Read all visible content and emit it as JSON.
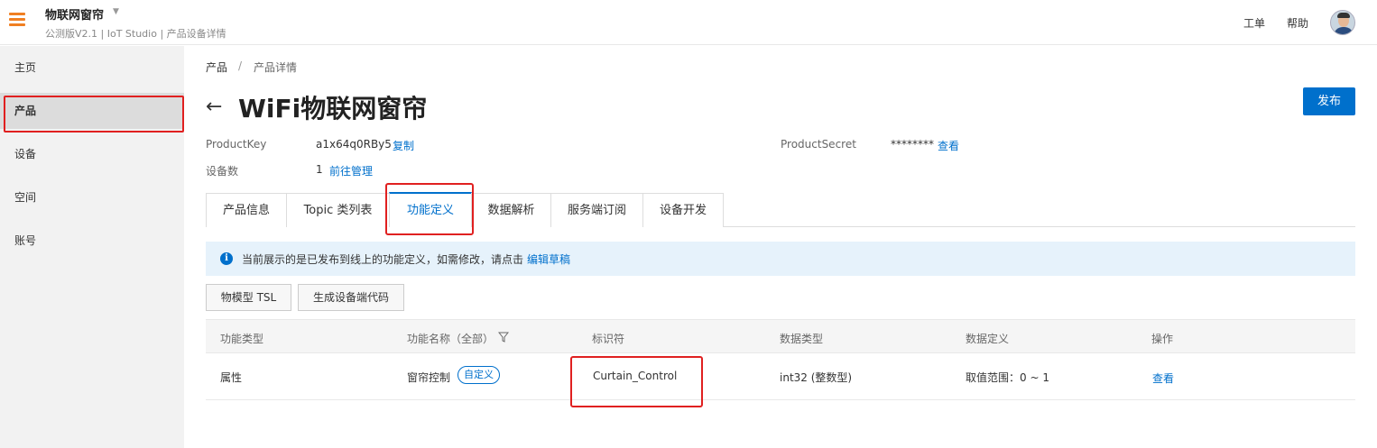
{
  "header": {
    "app_name": "物联网窗帘",
    "subtitle": "公测版V2.1 | IoT Studio | 产品设备详情",
    "links": [
      "工单",
      "帮助"
    ]
  },
  "sidebar": {
    "items": [
      {
        "label": "主页"
      },
      {
        "label": "产品",
        "active": true
      },
      {
        "label": "设备"
      },
      {
        "label": "空间"
      },
      {
        "label": "账号"
      }
    ]
  },
  "breadcrumb": {
    "items": [
      "产品",
      "产品详情"
    ],
    "separator": "/"
  },
  "page": {
    "title": "WiFi物联网窗帘",
    "publish_label": "发布"
  },
  "meta": {
    "product_key_label": "ProductKey",
    "product_key_value": "a1x64q0RBy5",
    "copy_label": "复制",
    "product_secret_label": "ProductSecret",
    "product_secret_value": "********",
    "view_label": "查看",
    "device_count_label": "设备数",
    "device_count_value": "1",
    "manage_label": "前往管理"
  },
  "tabs": [
    {
      "label": "产品信息"
    },
    {
      "label": "Topic 类列表"
    },
    {
      "label": "功能定义",
      "active": true
    },
    {
      "label": "数据解析"
    },
    {
      "label": "服务端订阅"
    },
    {
      "label": "设备开发"
    }
  ],
  "notice": {
    "text": "当前展示的是已发布到线上的功能定义，如需修改，请点击",
    "link": "编辑草稿"
  },
  "buttons": {
    "tsl": "物模型 TSL",
    "gen_code": "生成设备端代码"
  },
  "table": {
    "columns": [
      "功能类型",
      "功能名称（全部）",
      "标识符",
      "数据类型",
      "数据定义",
      "操作"
    ],
    "rows": [
      {
        "type": "属性",
        "name": "窗帘控制",
        "tag": "自定义",
        "identifier": "Curtain_Control",
        "data_type": "int32 (整数型)",
        "definition": "取值范围：0 ~ 1",
        "action": "查看"
      }
    ]
  },
  "colors": {
    "accent": "#0070cc",
    "highlight": "#e02020",
    "brand": "#f07f22"
  }
}
